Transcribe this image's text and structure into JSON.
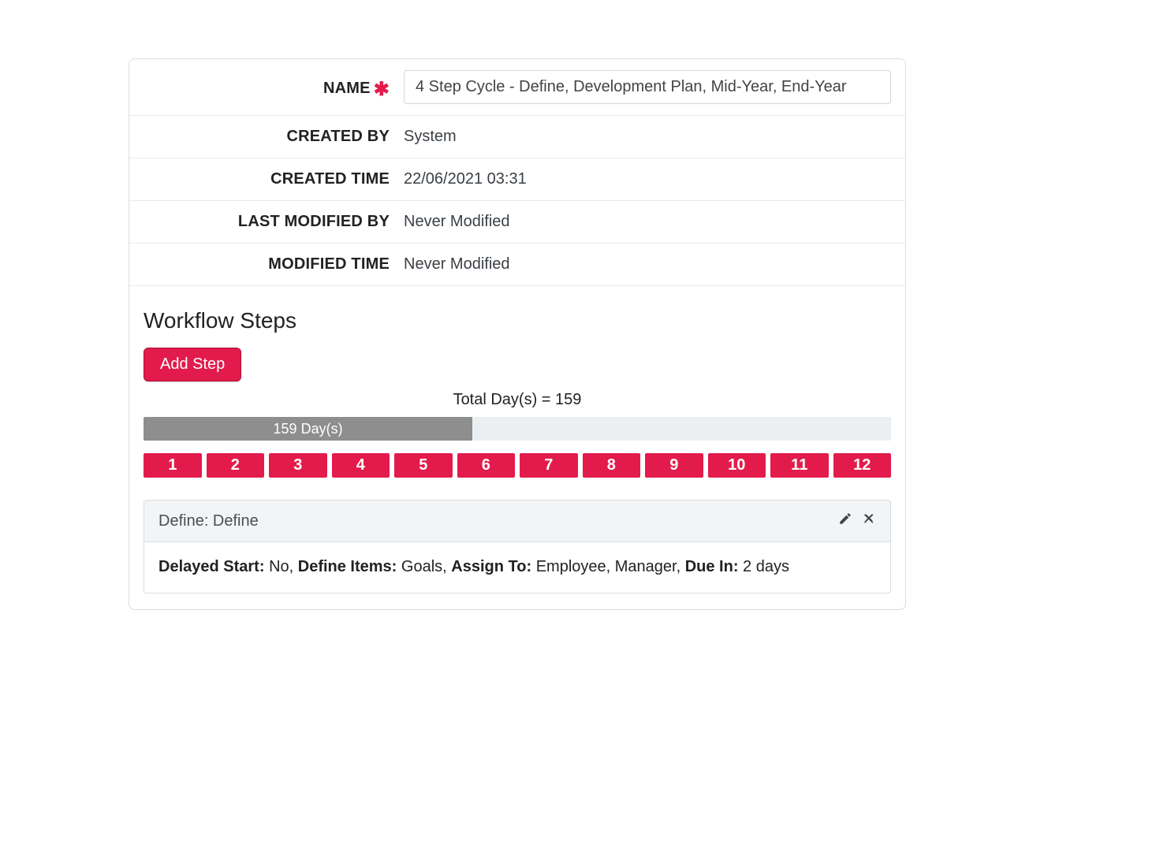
{
  "colors": {
    "accent": "#e31b4c"
  },
  "fields": {
    "name": {
      "label": "NAME",
      "value": "4 Step Cycle - Define, Development Plan, Mid-Year, End-Year",
      "required": true
    },
    "createdBy": {
      "label": "CREATED BY",
      "value": "System"
    },
    "createdTime": {
      "label": "CREATED TIME",
      "value": "22/06/2021 03:31"
    },
    "lastModifiedBy": {
      "label": "LAST MODIFIED BY",
      "value": "Never Modified"
    },
    "modifiedTime": {
      "label": "MODIFIED TIME",
      "value": "Never Modified"
    }
  },
  "workflow": {
    "heading": "Workflow Steps",
    "addButton": "Add Step",
    "total": {
      "label": "Total Day(s) = 159",
      "days": 159
    },
    "progress": {
      "label": "159 Day(s)",
      "percent": 44
    },
    "months": [
      "1",
      "2",
      "3",
      "4",
      "5",
      "6",
      "7",
      "8",
      "9",
      "10",
      "11",
      "12"
    ],
    "step": {
      "title": "Define: Define",
      "detail": {
        "delayedStart": {
          "label": "Delayed Start:",
          "value": "No,"
        },
        "defineItems": {
          "label": "Define Items:",
          "value": "Goals,"
        },
        "assignTo": {
          "label": "Assign To:",
          "value": "Employee, Manager,"
        },
        "dueIn": {
          "label": "Due In:",
          "value": "2 days"
        }
      }
    }
  }
}
